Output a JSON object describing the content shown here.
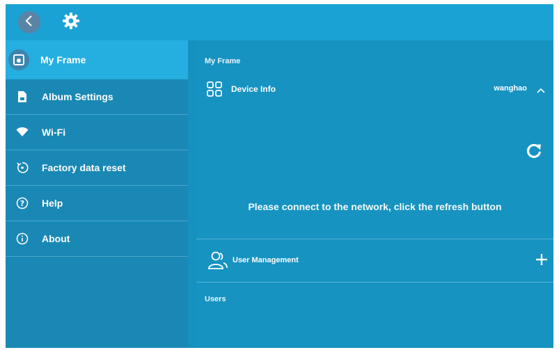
{
  "colors": {
    "topbar": "#1ba2d5",
    "sidebar": "#1a88b4",
    "sidebar_active": "#25aee0",
    "content": "#1693c1",
    "back_button": "#5a84a6"
  },
  "topbar": {
    "back_icon": "chevron-left-icon",
    "settings_icon": "gear-icon"
  },
  "sidebar": {
    "items": [
      {
        "label": "My Frame",
        "icon": "frame-icon",
        "active": true
      },
      {
        "label": "Album Settings",
        "icon": "album-icon",
        "active": false
      },
      {
        "label": "Wi-Fi",
        "icon": "wifi-icon",
        "active": false
      },
      {
        "label": "Factory data reset",
        "icon": "reset-icon",
        "active": false
      },
      {
        "label": "Help",
        "icon": "help-icon",
        "active": false
      },
      {
        "label": "About",
        "icon": "info-icon",
        "active": false
      }
    ]
  },
  "main": {
    "breadcrumb": "My Frame",
    "device_info": {
      "title": "Device Info",
      "device_name": "wanghao",
      "refresh_icon": "refresh-icon",
      "message": "Please connect to the network, click the refresh button"
    },
    "user_management": {
      "title": "User Management",
      "add_icon": "plus-icon"
    },
    "users_label": "Users"
  }
}
